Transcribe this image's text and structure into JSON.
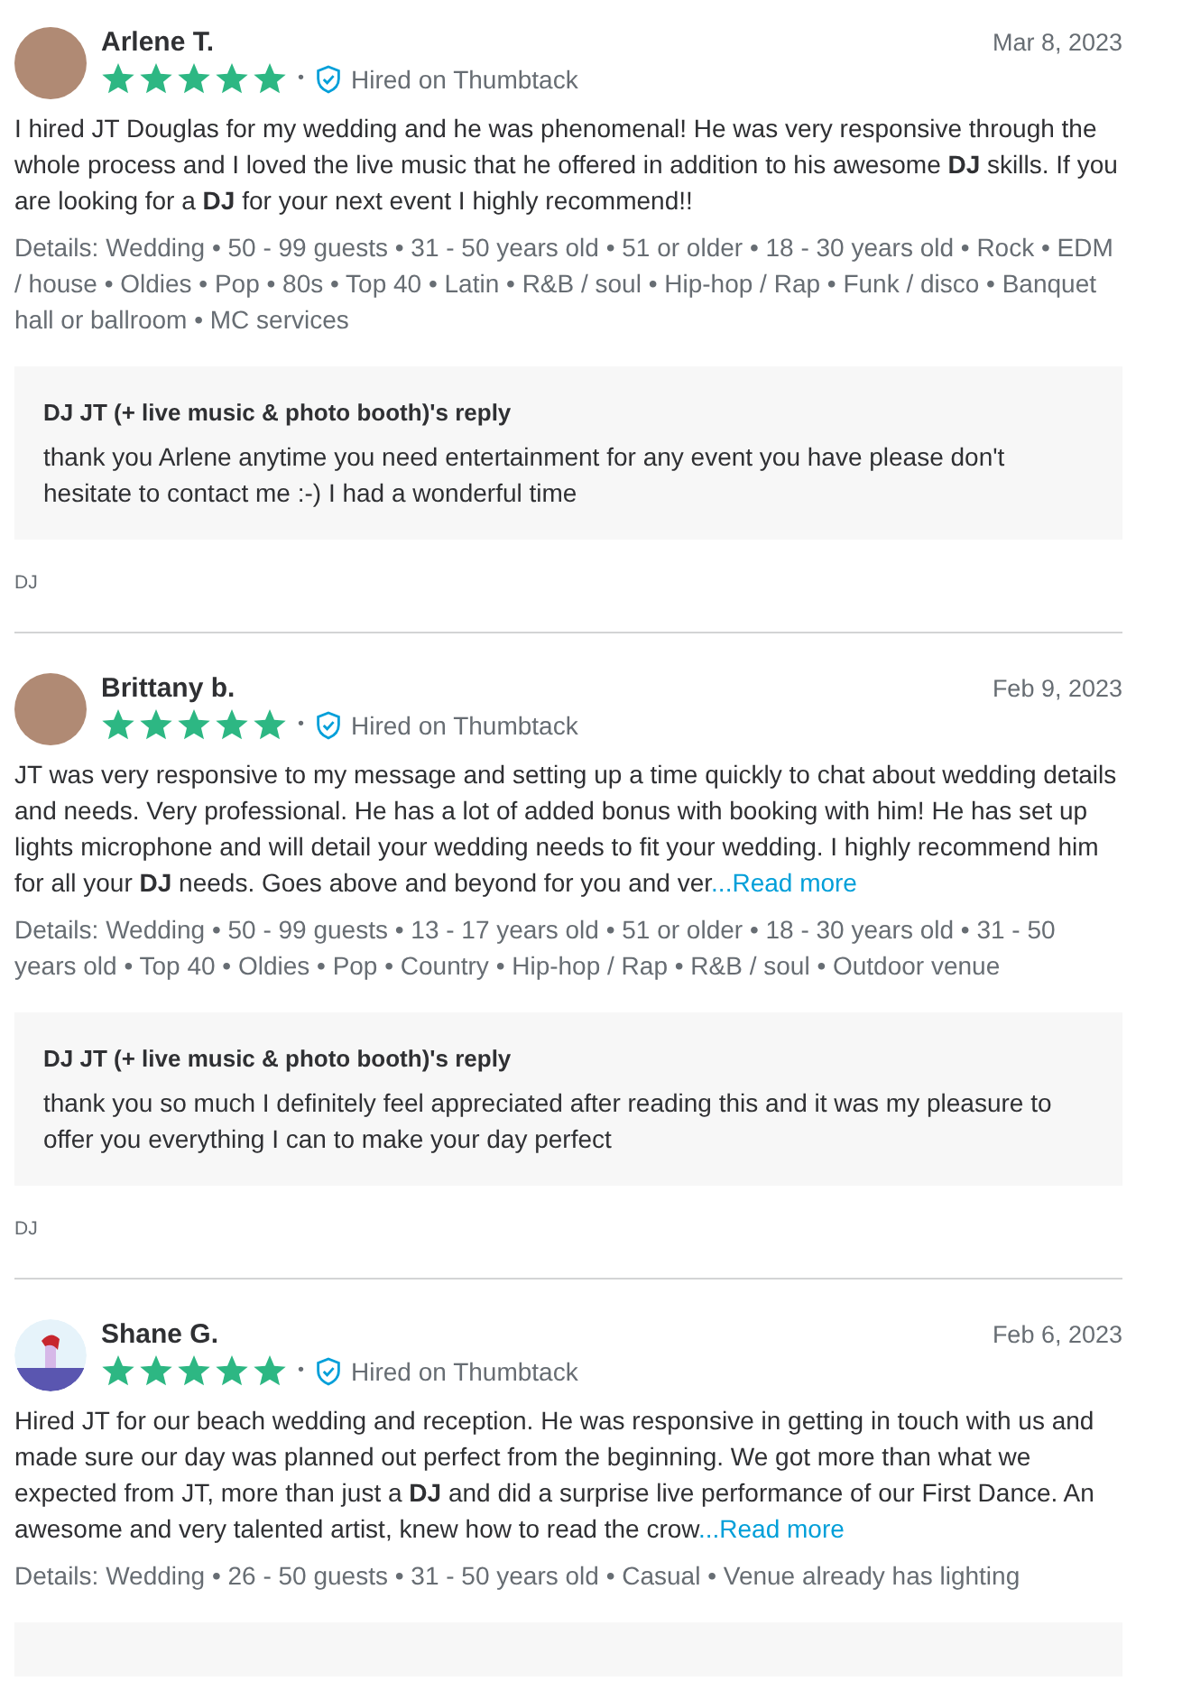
{
  "reviews": [
    {
      "name": "Arlene T.",
      "kind": "photo",
      "date": "Mar 8, 2023",
      "stars": 5,
      "separator": "•",
      "badge": "Hired on Thumbtack",
      "body": "I hired JT Douglas for my wedding and he was phenomenal! He was very responsive through the whole process and I loved the live music that he offered in addition to his awesome **DJ** skills. If you are looking for a **DJ** for your next event I highly recommend!!",
      "details": "Details: Wedding • 50 - 99 guests • 31 - 50 years old • 51 or older • 18 - 30 years old • Rock • EDM / house • Oldies • Pop • 80s • Top 40 • Latin • R&B / soul • Hip-hop / Rap • Funk / disco • Banquet hall or ballroom • MC services",
      "reply": {
        "kind": "full",
        "title": "DJ JT (+ live music & photo booth)'s reply",
        "text": "thank you Arlene anytime you need entertainment for any event you have please don't hesitate to contact me :-) I had a wonderful time"
      },
      "tag": "DJ"
    },
    {
      "name": "Brittany b.",
      "kind": "photo",
      "date": "Feb 9, 2023",
      "stars": 5,
      "separator": "•",
      "badge": "Hired on Thumbtack",
      "body": "JT was very responsive to my message and setting up a time quickly to chat about wedding details and needs. Very professional. He has a lot of added bonus with booking with him! He has set up lights microphone and will detail your wedding needs to fit your wedding. I highly recommend him for all your **DJ** needs. Goes above and beyond for you and ver",
      "read_more": "...Read more",
      "details": "Details: Wedding • 50 - 99 guests • 13 - 17 years old • 51 or older • 18 - 30 years old • 31 - 50 years old • Top 40 • Oldies • Pop • Country • Hip-hop / Rap • R&B / soul • Outdoor venue",
      "reply": {
        "kind": "full",
        "title": "DJ JT (+ live music & photo booth)'s reply",
        "text": "thank you so much I definitely feel appreciated after reading this and it was my pleasure to offer you everything I can to make your day perfect"
      },
      "tag": "DJ"
    },
    {
      "name": "Shane G.",
      "kind": "illustration",
      "date": "Feb 6, 2023",
      "stars": 5,
      "separator": "•",
      "badge": "Hired on Thumbtack",
      "body": "Hired JT for our beach wedding and reception. He was responsive in getting in touch with us and made sure our day was planned out perfect from the beginning. We got more than what we expected from JT, more than just a **DJ** and did a surprise live performance of our First Dance. An awesome and very talented artist, knew how to read the crow",
      "read_more": "...Read more",
      "details": "Details: Wedding • 26 - 50 guests • 31 - 50 years old • Casual • Venue already has lighting",
      "reply": {
        "kind": "cut"
      }
    }
  ]
}
